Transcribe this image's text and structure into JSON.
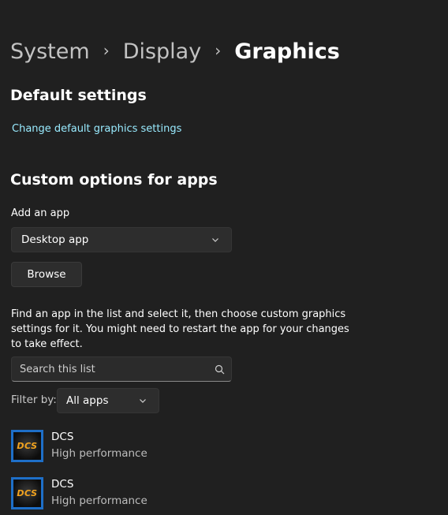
{
  "breadcrumb": {
    "items": [
      "System",
      "Display",
      "Graphics"
    ]
  },
  "default_settings": {
    "title": "Default settings",
    "link": "Change default graphics settings"
  },
  "custom_options": {
    "title": "Custom options for apps",
    "add_app_label": "Add an app",
    "app_type_selected": "Desktop app",
    "browse_label": "Browse",
    "description": "Find an app in the list and select it, then choose custom graphics settings for it. You might need to restart the app for your changes to take effect.",
    "search_placeholder": "Search this list",
    "filter_label": "Filter by:",
    "filter_selected": "All apps"
  },
  "apps": [
    {
      "name": "DCS",
      "setting": "High performance",
      "icon_text": "DCS"
    },
    {
      "name": "DCS",
      "setting": "High performance",
      "icon_text": "DCS"
    }
  ],
  "colors": {
    "background": "#202020",
    "link": "#99ebff",
    "icon_border": "#1e6fc8",
    "icon_text": "#f2a31f"
  }
}
